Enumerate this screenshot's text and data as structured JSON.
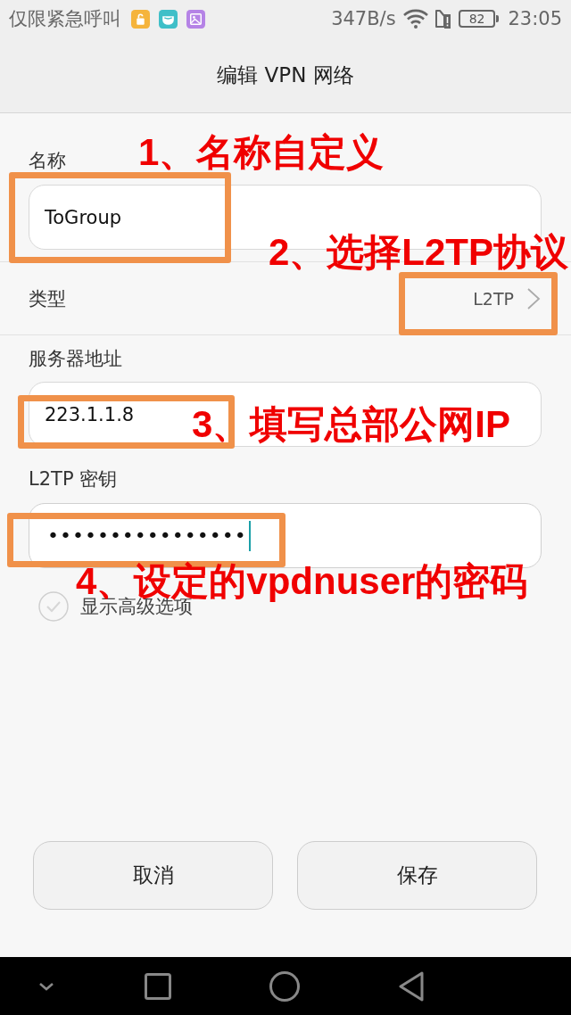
{
  "status_bar": {
    "carrier": "仅限紧急呼叫",
    "speed": "347B/s",
    "battery": "82",
    "time": "23:05"
  },
  "header": {
    "title": "编辑 VPN 网络"
  },
  "form": [
    {
      "kind": "text",
      "label": "名称",
      "value": "ToGroup",
      "focused": false
    },
    {
      "kind": "select",
      "label": "类型",
      "value": "L2TP",
      "focused": false
    },
    {
      "kind": "text",
      "label": "服务器地址",
      "value": "223.1.1.8",
      "focused": false
    },
    {
      "kind": "password",
      "label": "L2TP 密钥",
      "value": "••••••••••••••••",
      "focused": true
    }
  ],
  "advanced_option": {
    "label": "显示高级选项",
    "checked": false
  },
  "buttons": [
    {
      "label": "取消"
    },
    {
      "label": "保存"
    }
  ],
  "annotations": [
    {
      "text": "1、名称自定义"
    },
    {
      "text": "2、选择L2TP协议"
    },
    {
      "text": "3、填写总部公网IP"
    },
    {
      "text": "4、设定的vpdnuser的密码"
    }
  ]
}
